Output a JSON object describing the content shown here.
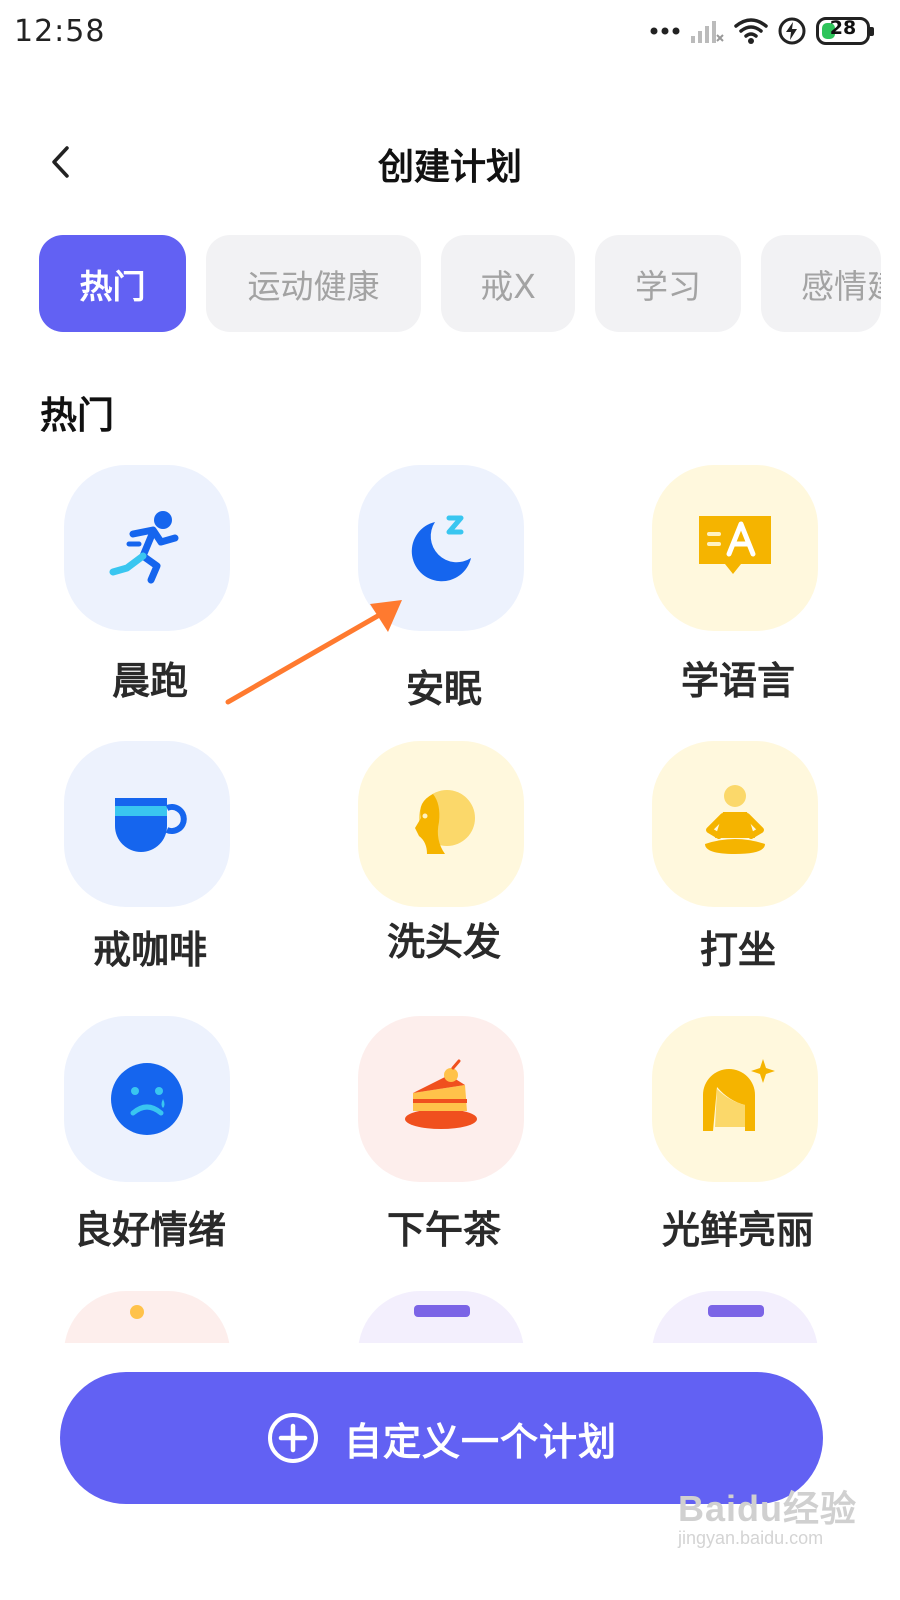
{
  "status_bar": {
    "time": "12:58",
    "battery_level": "28",
    "battery_fraction": 0.28,
    "icons": [
      "dots-icon",
      "signal-off-icon",
      "wifi-icon",
      "charging-icon",
      "battery-icon"
    ]
  },
  "header": {
    "title": "创建计划",
    "back_icon": "chevron-left-icon"
  },
  "tabs": [
    {
      "label": "热门",
      "active": true
    },
    {
      "label": "运动健康",
      "active": false
    },
    {
      "label": "戒X",
      "active": false
    },
    {
      "label": "学习",
      "active": false
    },
    {
      "label": "感情建",
      "active": false
    }
  ],
  "section": {
    "title": "热门"
  },
  "plans": [
    {
      "label": "晨跑",
      "icon": "running-icon",
      "bg": "#edf2fd"
    },
    {
      "label": "安眠",
      "icon": "moon-sleep-icon",
      "bg": "#edf2fd"
    },
    {
      "label": "学语言",
      "icon": "language-bubble-icon",
      "bg": "#fff8dd"
    },
    {
      "label": "戒咖啡",
      "icon": "coffee-cup-icon",
      "bg": "#edf2fd"
    },
    {
      "label": "洗头发",
      "icon": "head-hair-icon",
      "bg": "#fff8dd"
    },
    {
      "label": "打坐",
      "icon": "meditation-icon",
      "bg": "#fff8dd"
    },
    {
      "label": "良好情绪",
      "icon": "sad-face-icon",
      "bg": "#edf2fd"
    },
    {
      "label": "下午茶",
      "icon": "cake-icon",
      "bg": "#fdeeec"
    },
    {
      "label": "光鲜亮丽",
      "icon": "sparkle-hair-icon",
      "bg": "#fff8dd"
    }
  ],
  "partial_plans": [
    {
      "icon": "partial-icon",
      "bg": "#fdeeec"
    },
    {
      "icon": "partial-icon",
      "bg": "#f3effd"
    },
    {
      "icon": "partial-icon",
      "bg": "#f3effd"
    }
  ],
  "custom_button": {
    "label": "自定义一个计划",
    "icon": "plus-circle-icon"
  },
  "watermark": {
    "main": "Baidu经验",
    "sub": "jingyan.baidu.com"
  },
  "colors": {
    "accent": "#6261f3",
    "icon_blue": "#1565ee",
    "icon_yellow": "#f5b400",
    "annotation_arrow": "#ff7a2f"
  }
}
